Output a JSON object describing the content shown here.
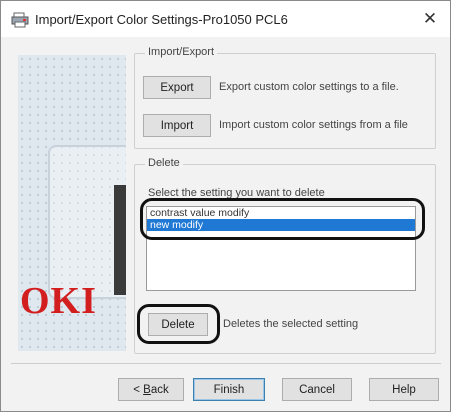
{
  "window": {
    "title": "Import/Export Color Settings-Pro1050 PCL6",
    "close_glyph": "✕"
  },
  "side_panel": {
    "logo_text": "OKI",
    "logo_color": "#d21e1e"
  },
  "import_export": {
    "group_label": "Import/Export",
    "export_button": "Export",
    "export_desc": "Export custom color settings to a file.",
    "import_button": "Import",
    "import_desc": "Import custom color settings from a file"
  },
  "delete_section": {
    "group_label": "Delete",
    "instruction": "Select the setting you want to delete",
    "items": [
      {
        "label": "contrast value modify",
        "selected": false
      },
      {
        "label": "new modify",
        "selected": true
      }
    ],
    "delete_button": "Delete",
    "delete_desc": "Deletes the selected setting"
  },
  "footer": {
    "back_prefix": "< ",
    "back_accel": "B",
    "back_rest": "ack",
    "finish_button": "Finish",
    "cancel_button": "Cancel",
    "help_button": "Help"
  },
  "colors": {
    "selection": "#1e78d4",
    "accent_border": "#3c7fb1"
  }
}
